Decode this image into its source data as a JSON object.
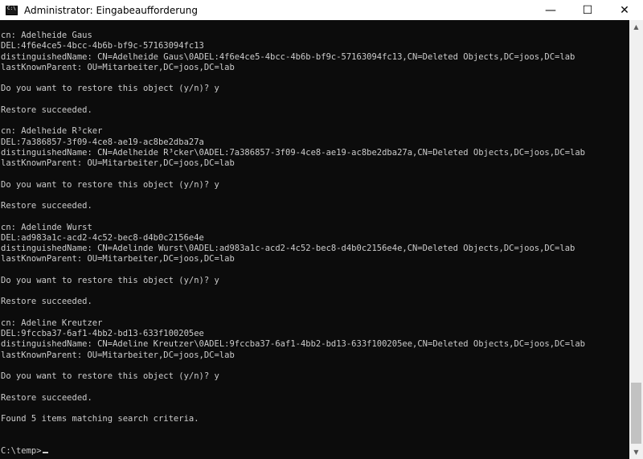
{
  "window": {
    "title": "Administrator: Eingabeaufforderung",
    "controls": {
      "minimize": "—",
      "maximize": "☐",
      "close": "✕"
    }
  },
  "console": {
    "lines": [
      "cn: Adelheide Gaus",
      "DEL:4f6e4ce5-4bcc-4b6b-bf9c-57163094fc13",
      "distinguishedName: CN=Adelheide Gaus\\0ADEL:4f6e4ce5-4bcc-4b6b-bf9c-57163094fc13,CN=Deleted Objects,DC=joos,DC=lab",
      "lastKnownParent: OU=Mitarbeiter,DC=joos,DC=lab",
      "",
      "Do you want to restore this object (y/n)? y",
      "",
      "Restore succeeded.",
      "",
      "cn: Adelheide R³cker",
      "DEL:7a386857-3f09-4ce8-ae19-ac8be2dba27a",
      "distinguishedName: CN=Adelheide R³cker\\0ADEL:7a386857-3f09-4ce8-ae19-ac8be2dba27a,CN=Deleted Objects,DC=joos,DC=lab",
      "lastKnownParent: OU=Mitarbeiter,DC=joos,DC=lab",
      "",
      "Do you want to restore this object (y/n)? y",
      "",
      "Restore succeeded.",
      "",
      "cn: Adelinde Wurst",
      "DEL:ad983a1c-acd2-4c52-bec8-d4b0c2156e4e",
      "distinguishedName: CN=Adelinde Wurst\\0ADEL:ad983a1c-acd2-4c52-bec8-d4b0c2156e4e,CN=Deleted Objects,DC=joos,DC=lab",
      "lastKnownParent: OU=Mitarbeiter,DC=joos,DC=lab",
      "",
      "Do you want to restore this object (y/n)? y",
      "",
      "Restore succeeded.",
      "",
      "cn: Adeline Kreutzer",
      "DEL:9fccba37-6af1-4bb2-bd13-633f100205ee",
      "distinguishedName: CN=Adeline Kreutzer\\0ADEL:9fccba37-6af1-4bb2-bd13-633f100205ee,CN=Deleted Objects,DC=joos,DC=lab",
      "lastKnownParent: OU=Mitarbeiter,DC=joos,DC=lab",
      "",
      "Do you want to restore this object (y/n)? y",
      "",
      "Restore succeeded.",
      "",
      "Found 5 items matching search criteria.",
      "",
      ""
    ],
    "prompt": "C:\\temp>",
    "text_color": "#cccccc",
    "background_color": "#0c0c0c"
  },
  "scrollbar": {
    "up_arrow": "▲",
    "down_arrow": "▼"
  }
}
